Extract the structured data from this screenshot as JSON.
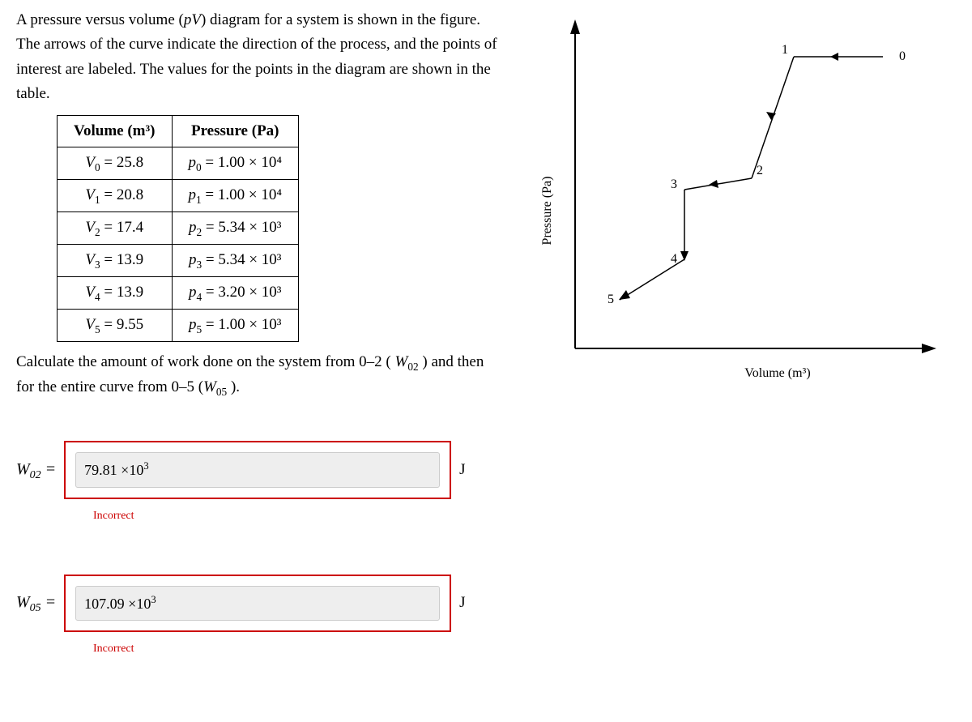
{
  "intro": "A pressure versus volume (pV) diagram for a system is shown in the figure. The arrows of the curve indicate the direction of the process, and the points of interest are labeled. The values for the points in the diagram are shown in the table.",
  "table": {
    "header_vol": "Volume (m³)",
    "header_press": "Pressure (Pa)",
    "rows": [
      {
        "vol_var": "V₀",
        "vol_val": "25.8",
        "p_var": "p₀",
        "p_val": "1.00 × 10⁴"
      },
      {
        "vol_var": "V₁",
        "vol_val": "20.8",
        "p_var": "p₁",
        "p_val": "1.00 × 10⁴"
      },
      {
        "vol_var": "V₂",
        "vol_val": "17.4",
        "p_var": "p₂",
        "p_val": "5.34 × 10³"
      },
      {
        "vol_var": "V₃",
        "vol_val": "13.9",
        "p_var": "p₃",
        "p_val": "5.34 × 10³"
      },
      {
        "vol_var": "V₄",
        "vol_val": "13.9",
        "p_var": "p₄",
        "p_val": "3.20 × 10³"
      },
      {
        "vol_var": "V₅",
        "vol_val": "9.55",
        "p_var": "p₅",
        "p_val": "1.00 × 10³"
      }
    ]
  },
  "question_part1": "Calculate the amount of work done on the system from 0–2 (",
  "question_part2": "W₀₂",
  "question_part3": ") and then for the entire curve from 0–5 (W₀₅).",
  "answers": {
    "w02": {
      "label": "W₀₂ =",
      "value": "79.81 ×10³",
      "unit": "J",
      "feedback": "Incorrect"
    },
    "w05": {
      "label": "W₀₅ =",
      "value": "107.09 ×10³",
      "unit": "J",
      "feedback": "Incorrect"
    }
  },
  "graph": {
    "ylabel": "Pressure (Pa)",
    "xlabel": "Volume (m³)",
    "points": [
      "0",
      "1",
      "2",
      "3",
      "4",
      "5"
    ]
  }
}
